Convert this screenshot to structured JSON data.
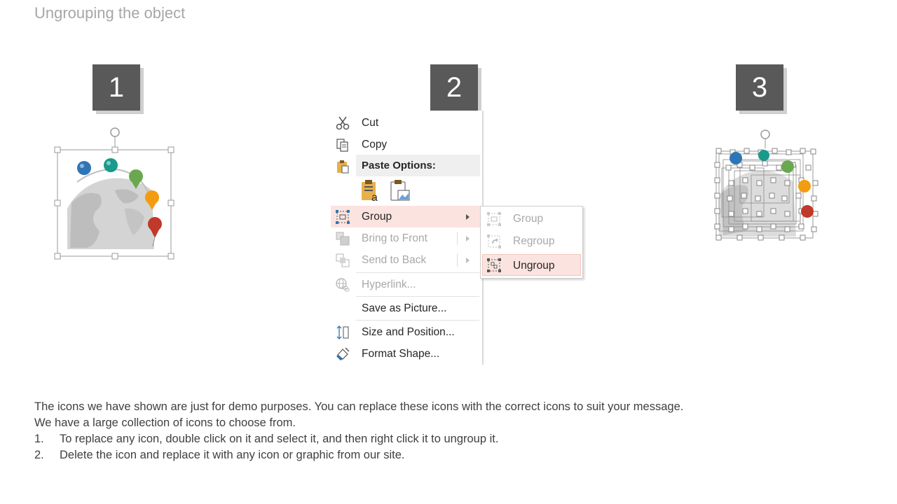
{
  "slide": {
    "title": "Ungrouping the object"
  },
  "steps": [
    "1",
    "2",
    "3"
  ],
  "context_menu": {
    "cut": "Cut",
    "copy": "Copy",
    "paste_options": "Paste Options:",
    "group": "Group",
    "bring_to_front": "Bring to Front",
    "send_to_back": "Send to Back",
    "hyperlink": "Hyperlink...",
    "save_as_picture": "Save as Picture...",
    "size_and_position": "Size and Position...",
    "format_shape": "Format Shape..."
  },
  "submenu": {
    "group": "Group",
    "regroup": "Regroup",
    "ungroup": "Ungroup"
  },
  "description": {
    "intro_line1": "The icons we have shown are just for demo purposes. You can replace these icons with the correct icons to suit your message.",
    "intro_line2": "We have a large collection of icons to choose from.",
    "items": [
      {
        "num": "1.",
        "text": "To replace any icon, double click on it and select it, and then right click it to ungroup it."
      },
      {
        "num": "2.",
        "text": "Delete the icon and replace it with any icon or graphic from our site."
      }
    ]
  },
  "colors": {
    "step_box": "#595959",
    "highlight": "#fbe3df",
    "pin_blue": "#2e75b6",
    "pin_teal": "#1a9a8a",
    "pin_green": "#6aa84f",
    "pin_orange": "#f39c12",
    "pin_red": "#c0392b"
  }
}
